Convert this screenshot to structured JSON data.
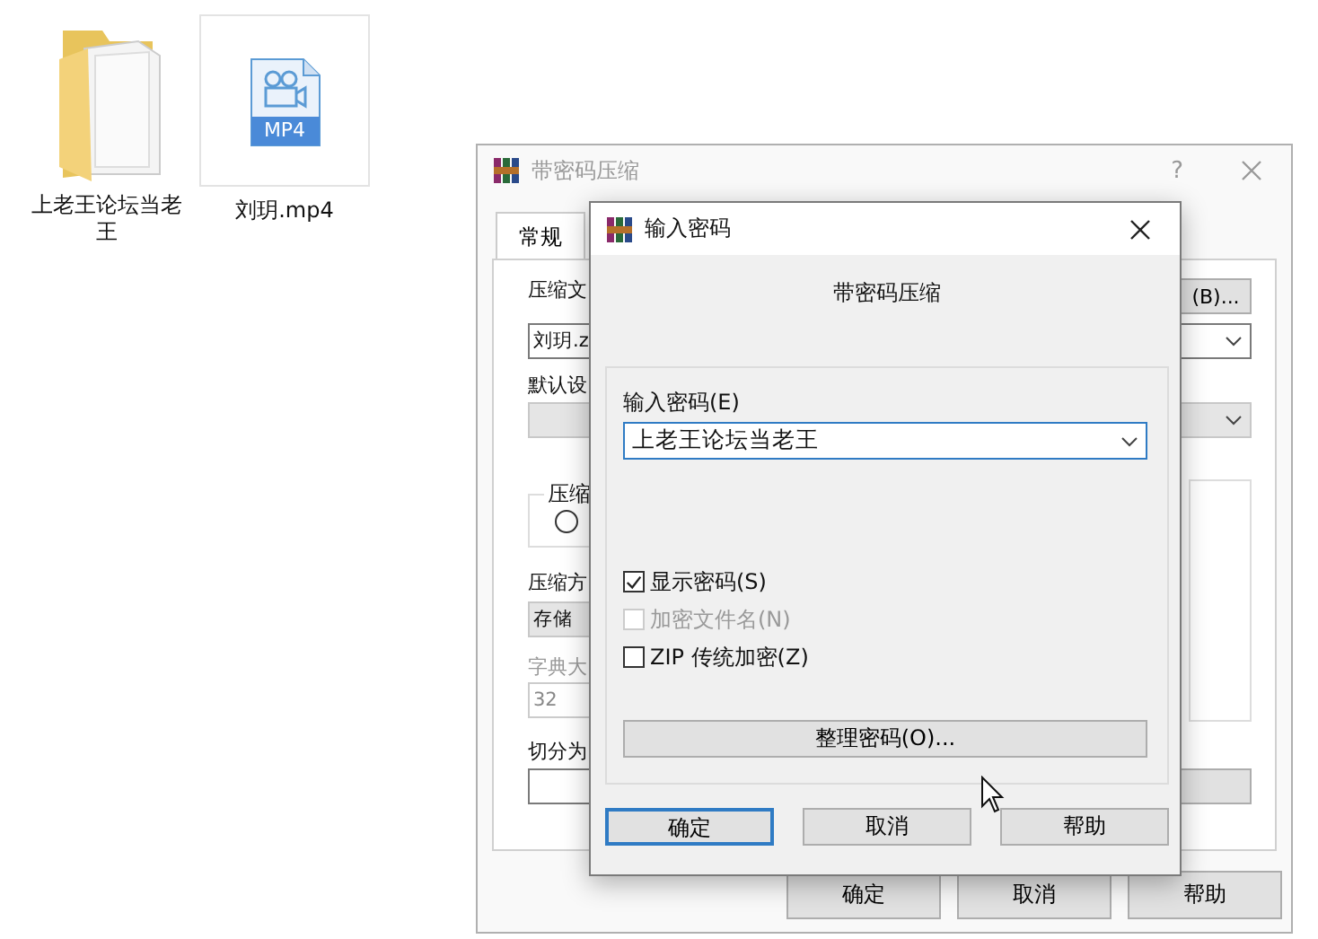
{
  "desktop": {
    "icons": [
      {
        "kind": "folder",
        "label": "上老王论坛当老王",
        "highlighted": false
      },
      {
        "kind": "video",
        "label": "刘玥.mp4",
        "badge": "MP4",
        "highlighted": true
      }
    ]
  },
  "back_window": {
    "title": "带密码压缩",
    "help": "?",
    "tabs": [
      {
        "label": "常规",
        "selected": true
      }
    ],
    "archive_name": {
      "label": "压缩文",
      "value": "刘玥.z",
      "browse_button": "(B)..."
    },
    "profile": {
      "label": "默认设"
    },
    "format_group": {
      "label": "压缩",
      "option_selected": false
    },
    "method": {
      "label": "压缩方",
      "value": "存储"
    },
    "dictionary": {
      "label": "字典大",
      "value": "32",
      "disabled": true
    },
    "split": {
      "label": "切分为"
    },
    "buttons": [
      "确定",
      "取消",
      "帮助"
    ]
  },
  "dialog": {
    "title": "输入密码",
    "heading": "带密码压缩",
    "password": {
      "label": "输入密码(E)",
      "value": "上老王论坛当老王"
    },
    "options": [
      {
        "label": "显示密码(S)",
        "checked": true,
        "disabled": false
      },
      {
        "label": "加密文件名(N)",
        "checked": false,
        "disabled": true
      },
      {
        "label": "ZIP 传统加密(Z)",
        "checked": false,
        "disabled": false
      }
    ],
    "organize_button": "整理密码(O)...",
    "buttons": [
      {
        "label": "确定",
        "default": true
      },
      {
        "label": "取消",
        "default": false
      },
      {
        "label": "帮助",
        "default": false
      }
    ]
  }
}
